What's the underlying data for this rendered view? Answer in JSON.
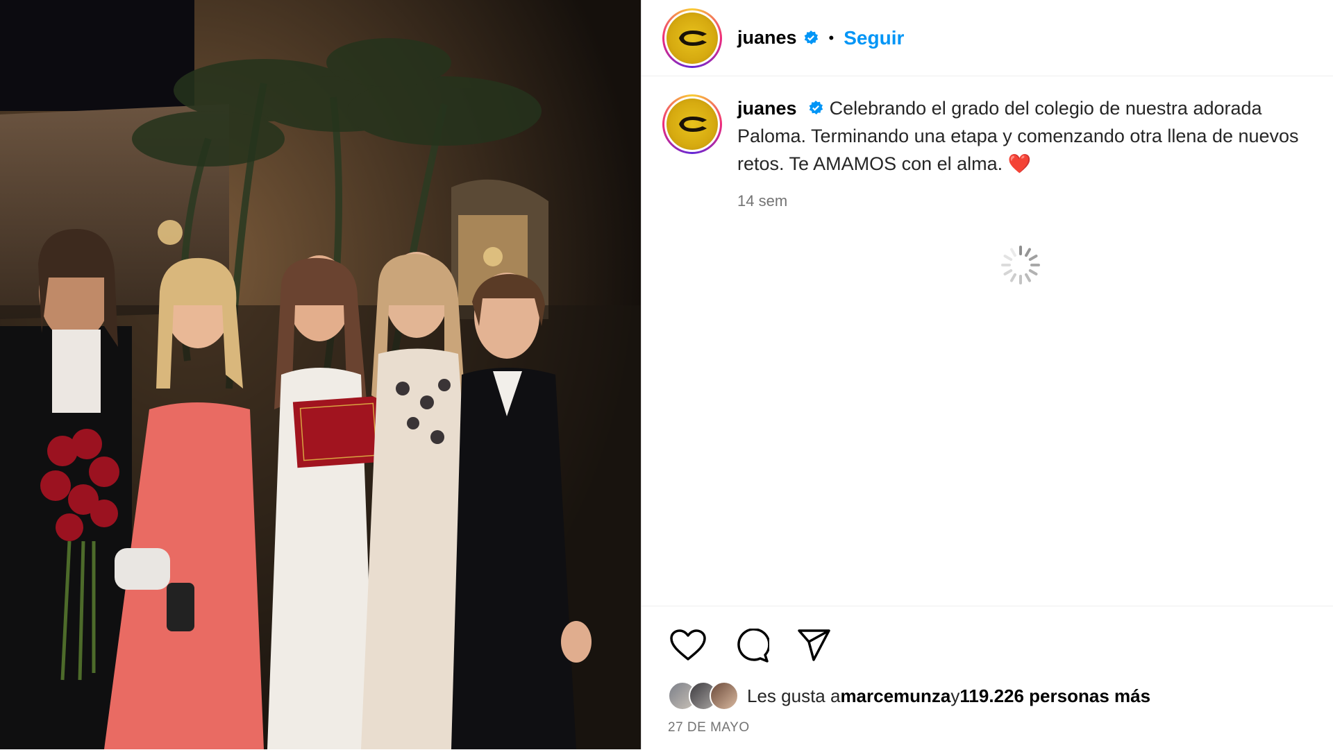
{
  "post": {
    "username": "juanes",
    "follow_label": "Seguir",
    "separator": "•",
    "caption": "Celebrando el grado del colegio de nuestra adorada Paloma. Terminando una etapa y comenzando otra llena de nuevos retos. Te AMAMOS con el alma.",
    "caption_emoji": "❤️",
    "time_ago": "14 sem",
    "likes_prefix": "Les gusta a ",
    "likes_user": "marcemunza",
    "likes_connector": " y ",
    "likes_count": "119.226 personas más",
    "date": "27 DE MAYO"
  },
  "colors": {
    "follow": "#0095f6",
    "verified": "#0095f6",
    "heart": "#e0102b"
  },
  "icons": [
    "verified-icon",
    "like-icon",
    "comment-icon",
    "share-icon",
    "loading-spinner-icon"
  ]
}
